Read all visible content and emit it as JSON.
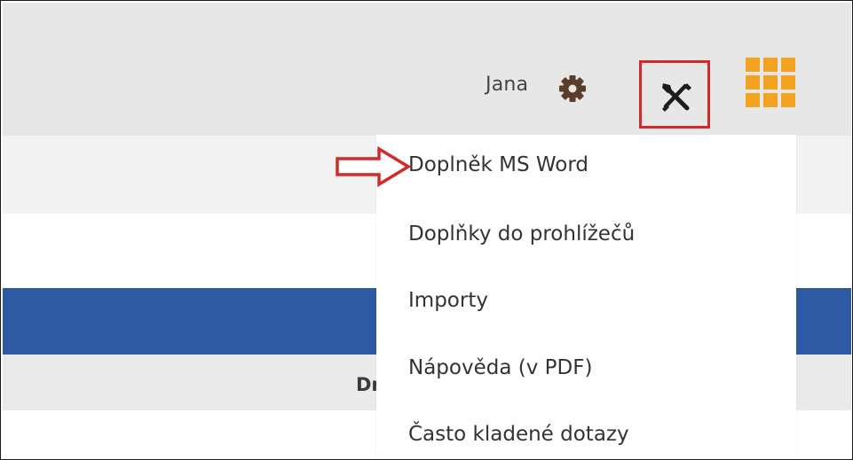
{
  "header": {
    "user_name": "Jana",
    "icons": {
      "settings": "gear-icon",
      "tools": "tools-icon",
      "apps": "apps-grid-icon"
    }
  },
  "tools_menu": {
    "items": [
      {
        "label": "Doplněk MS Word"
      },
      {
        "label": "Doplňky do prohlížečů"
      },
      {
        "label": "Importy"
      },
      {
        "label": "Nápověda (v PDF)"
      },
      {
        "label": "Často kladené dotazy"
      }
    ]
  },
  "table": {
    "partial_header": "Dru"
  },
  "colors": {
    "highlight_red": "#d12a2a",
    "apps_orange": "#f4a320",
    "nav_blue": "#2e5aa4",
    "icon_dark": "#5a3e2b"
  }
}
